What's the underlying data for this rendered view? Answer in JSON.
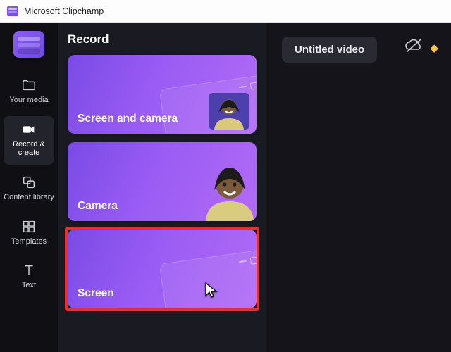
{
  "window": {
    "title": "Microsoft Clipchamp"
  },
  "sidebar": {
    "items": [
      {
        "label": "Your media"
      },
      {
        "label": "Record & create"
      },
      {
        "label": "Content library"
      },
      {
        "label": "Templates"
      },
      {
        "label": "Text"
      }
    ],
    "active_index": 1
  },
  "panel": {
    "heading": "Record",
    "cards": [
      {
        "label": "Screen and camera"
      },
      {
        "label": "Camera"
      },
      {
        "label": "Screen"
      }
    ],
    "highlighted_index": 2
  },
  "project": {
    "title": "Untitled video"
  },
  "icons": {
    "premium": "◆",
    "cloud_sync": "off"
  }
}
